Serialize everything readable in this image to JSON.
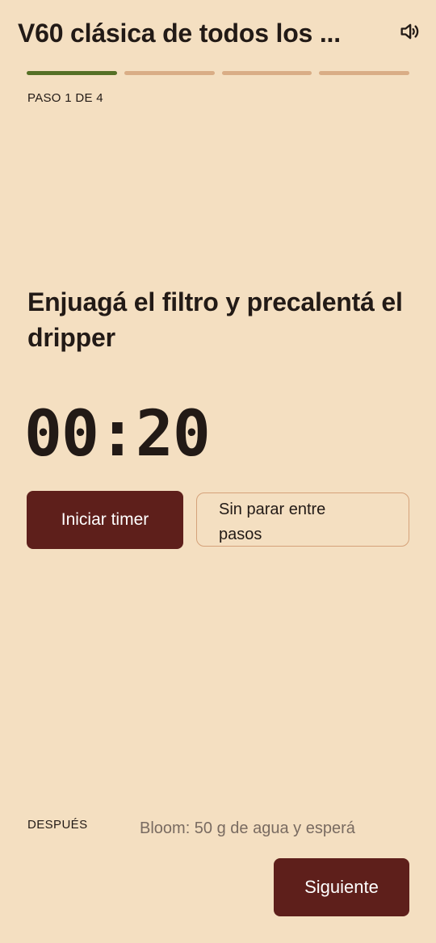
{
  "header": {
    "title": "V60 clásica de todos los ...",
    "sound_icon": "speaker-volume-icon"
  },
  "progress": {
    "total_steps": 4,
    "current_step": 1,
    "active_color": "#557026",
    "inactive_color": "#d9ad86"
  },
  "step": {
    "label": "PASO 1 DE 4",
    "instruction": "Enjuagá el filtro y precalentá el dripper",
    "timer": "00:20"
  },
  "actions": {
    "start_timer_label": "Iniciar timer",
    "continuous_label": "Sin parar entre pasos",
    "next_button_label": "Siguiente"
  },
  "upcoming": {
    "label": "DESPUÉS",
    "text": "Bloom: 50 g de agua y esperá"
  },
  "colors": {
    "background": "#f4dfc1",
    "primary_button": "#5e1f1b",
    "outline_button_border": "#d5a27a"
  }
}
